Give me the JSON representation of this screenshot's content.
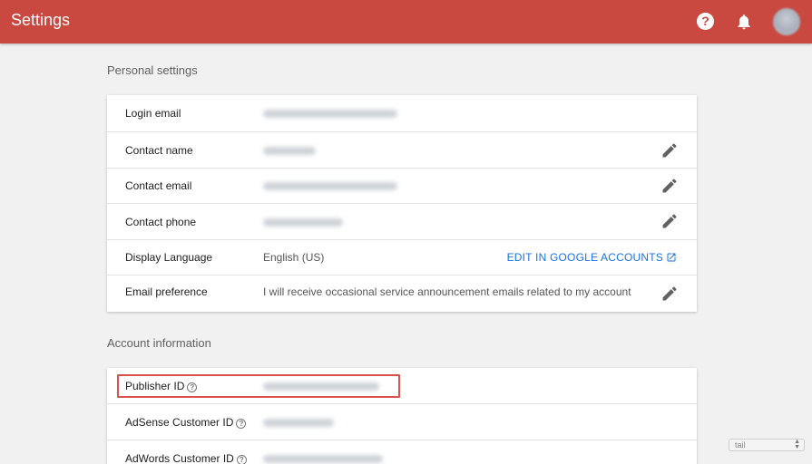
{
  "header": {
    "title": "Settings",
    "icons": [
      "help-icon",
      "bell-icon",
      "avatar"
    ],
    "background": "#c9483f"
  },
  "personal": {
    "section_title": "Personal settings",
    "rows": [
      {
        "label": "Login email",
        "value_redacted": true,
        "editable": false
      },
      {
        "label": "Contact name",
        "value_redacted": true,
        "editable": true
      },
      {
        "label": "Contact email",
        "value_redacted": true,
        "editable": true
      },
      {
        "label": "Contact phone",
        "value_redacted": true,
        "editable": true
      },
      {
        "label": "Display Language",
        "value": "English (US)",
        "link": "EDIT IN GOOGLE ACCOUNTS"
      },
      {
        "label": "Email preference",
        "value": "I will receive occasional service announcement emails related to my account",
        "editable": true
      }
    ]
  },
  "account": {
    "section_title": "Account information",
    "rows": [
      {
        "label": "Publisher ID",
        "value_redacted": true,
        "help": true
      },
      {
        "label": "AdSense Customer ID",
        "value_redacted": true,
        "help": true
      },
      {
        "label": "AdWords Customer ID",
        "value_redacted": true,
        "help": true
      }
    ]
  },
  "widget": {
    "select_value": "tail"
  },
  "colors": {
    "link": "#1a73e8",
    "highlight": "#d9534a"
  }
}
